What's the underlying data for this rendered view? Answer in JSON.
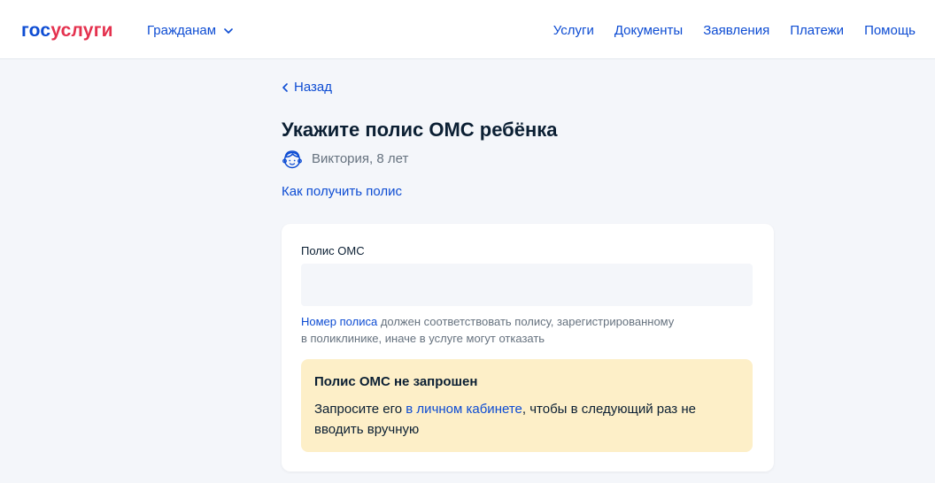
{
  "header": {
    "logo": {
      "part1": "гос",
      "part2": "услуги"
    },
    "audience_label": "Гражданам",
    "nav": [
      "Услуги",
      "Документы",
      "Заявления",
      "Платежи",
      "Помощь"
    ]
  },
  "main": {
    "back_label": "Назад",
    "title": "Укажите полис ОМС ребёнка",
    "child": {
      "name_age": "Виктория, 8 лет",
      "icon": "child-avatar-icon"
    },
    "how_to_get_link": "Как получить полис",
    "form": {
      "field_label": "Полис ОМС",
      "field_value": "",
      "field_placeholder": "",
      "hint": {
        "link": "Номер полиса",
        "rest_line1": " должен соответствовать полису, зарегистрированному",
        "rest_line2": "в поликлинике, иначе в услуге могут отказать"
      },
      "notice": {
        "title": "Полис ОМС не запрошен",
        "text_before": "Запросите его ",
        "link": "в личном кабинете",
        "text_after": ", чтобы в следующий раз не вводить вручную"
      }
    }
  },
  "colors": {
    "accent": "#0d4cd3",
    "brand_red": "#e4314e",
    "page_bg": "#f4f6fa",
    "notice_bg": "#fdefc8",
    "text_secondary": "#66727f"
  }
}
